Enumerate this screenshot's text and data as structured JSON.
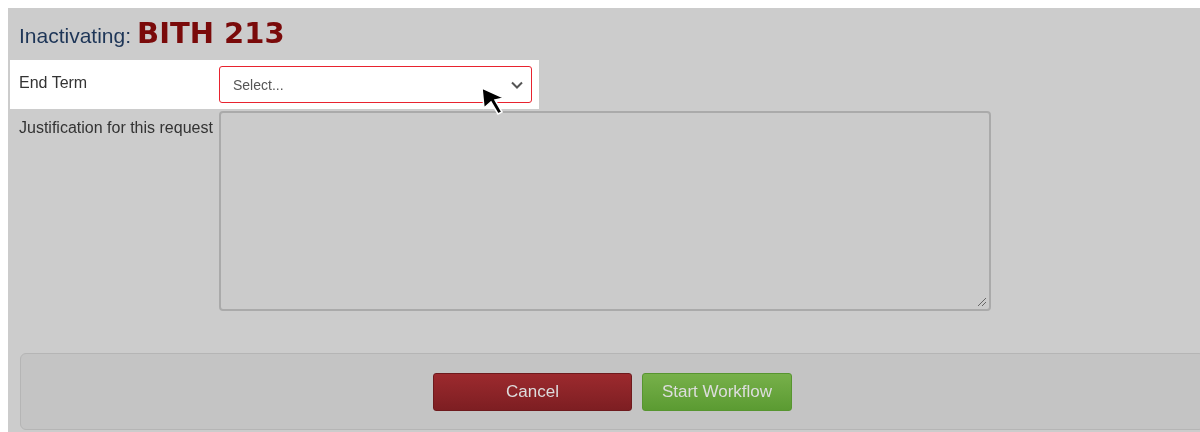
{
  "heading": {
    "prefix": "Inactivating:",
    "course": "BITH 213"
  },
  "fields": [
    {
      "kind": "select",
      "label": "End Term",
      "placeholder": "Select...",
      "invalid": true,
      "highlighted": true
    },
    {
      "kind": "textarea",
      "label": "Justification for this request",
      "invalid": false,
      "highlighted": false
    }
  ],
  "buttons": [
    {
      "label": "Cancel",
      "kind": "danger"
    },
    {
      "label": "Start Workflow",
      "kind": "success"
    }
  ]
}
